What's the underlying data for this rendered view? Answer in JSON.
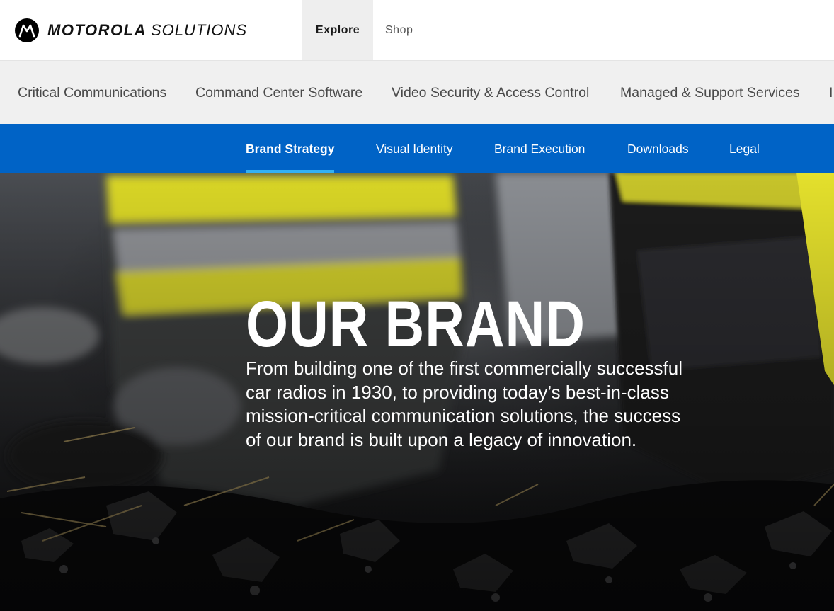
{
  "brand": {
    "mark_icon": "motorola-batwing-icon",
    "name_bold": "MOTOROLA",
    "name_light": "SOLUTIONS"
  },
  "top_nav": {
    "tabs": [
      {
        "label": "Explore",
        "active": true
      },
      {
        "label": "Shop",
        "active": false
      }
    ]
  },
  "category_nav": {
    "items": [
      {
        "label": "Critical Communications"
      },
      {
        "label": "Command Center Software"
      },
      {
        "label": "Video Security & Access Control"
      },
      {
        "label": "Managed & Support Services"
      },
      {
        "label": "I"
      }
    ]
  },
  "sub_nav": {
    "items": [
      {
        "label": "Brand Strategy",
        "active": true
      },
      {
        "label": "Visual Identity",
        "active": false
      },
      {
        "label": "Brand Execution",
        "active": false
      },
      {
        "label": "Downloads",
        "active": false
      },
      {
        "label": "Legal",
        "active": false
      }
    ]
  },
  "hero": {
    "title": "OUR BRAND",
    "body": "From building one of the first commercially successful car radios in 1930, to providing today’s best-in-class mission-critical communication solutions, the success of our brand is built upon a legacy of innovation."
  },
  "colors": {
    "subnav_blue": "#0063c6",
    "active_underline": "#33b1f2",
    "catbar_bg": "#f0f0f0",
    "hi_vis_yellow": "#e4e02c"
  }
}
